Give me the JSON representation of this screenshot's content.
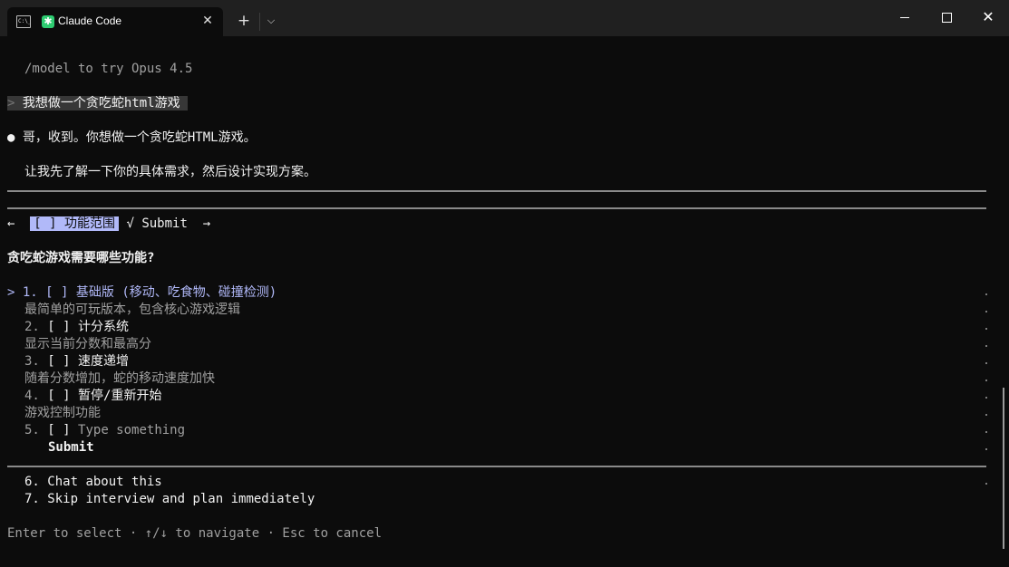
{
  "window": {
    "tab_title": "Claude Code",
    "term_icon_text": "C:\\_",
    "claude_icon": "✱",
    "close_tab": "✕",
    "new_tab": "+",
    "dropdown": "⌵",
    "close_window": "✕"
  },
  "terminal": {
    "model_hint": "/model to try Opus 4.5",
    "prompt_caret": ">",
    "user_prompt": "我想做一个贪吃蛇html游戏",
    "bullet": "●",
    "reply_1": "哥，收到。你想做一个贪吃蛇HTML游戏。",
    "reply_2": "让我先了解一下你的具体需求，然后设计实现方案。",
    "nav": {
      "left_arrow": "←",
      "active_tab": "[ ] 功能范围",
      "check": "√",
      "submit_tab": "Submit",
      "right_arrow": "→"
    },
    "question": "贪吃蛇游戏需要哪些功能?",
    "cursor": ">",
    "options": [
      {
        "number": "1.",
        "box": "[ ]",
        "label": "基础版 (移动、吃食物、碰撞检测)",
        "description": "最简单的可玩版本，包含核心游戏逻辑"
      },
      {
        "number": "2.",
        "box": "[ ]",
        "label": "计分系统",
        "description": "显示当前分数和最高分"
      },
      {
        "number": "3.",
        "box": "[ ]",
        "label": "速度递增",
        "description": "随着分数增加，蛇的移动速度加快"
      },
      {
        "number": "4.",
        "box": "[ ]",
        "label": "暂停/重新开始",
        "description": "游戏控制功能"
      },
      {
        "number": "5.",
        "box": "[ ]",
        "label": "Type something",
        "description": ""
      }
    ],
    "submit_label": "Submit",
    "extra_options": [
      {
        "number": "6.",
        "label": "Chat about this"
      },
      {
        "number": "7.",
        "label": "Skip interview and plan immediately"
      }
    ],
    "footer": "Enter to select · ↑/↓ to navigate · Esc to cancel"
  },
  "colors": {
    "background": "#0c0c0c",
    "titlebar": "#202020",
    "accent": "#b1b9f9",
    "dim_text": "#a0a0a0",
    "bright_text": "#f2f2f2"
  }
}
